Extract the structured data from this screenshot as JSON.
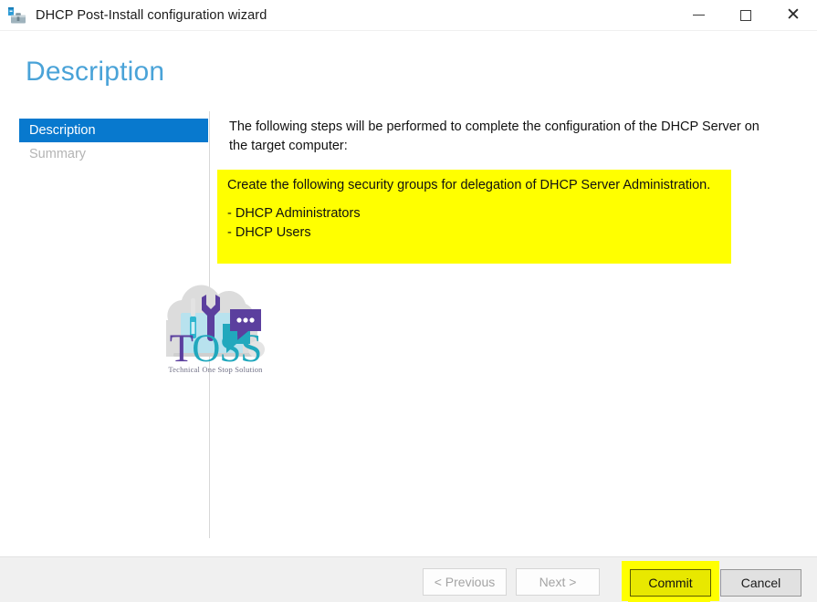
{
  "window": {
    "title": "DHCP Post-Install configuration wizard",
    "icon": "dhcp-toolbox-icon",
    "controls": {
      "minimize": "minimize-icon",
      "maximize": "maximize-icon",
      "close": "close-icon"
    }
  },
  "page": {
    "heading": "Description",
    "heading_color": "#4aa3d8"
  },
  "sidebar": {
    "items": [
      {
        "label": "Description",
        "state": "active"
      },
      {
        "label": "Summary",
        "state": "disabled"
      }
    ],
    "active_bg": "#0879ce"
  },
  "main": {
    "intro": "The following steps will be performed to complete the configuration of the DHCP Server on the target computer:",
    "highlight": {
      "bg_color": "#ffff00",
      "heading": "Create the following security groups for delegation of DHCP Server Administration.",
      "items": [
        "- DHCP Administrators",
        "- DHCP Users"
      ]
    }
  },
  "watermark": {
    "brand_letters": [
      "T",
      "O",
      "S",
      "S"
    ],
    "tagline": "Technical One Stop Solution",
    "purple": "#5b3f9e",
    "teal": "#21a8bd"
  },
  "footer": {
    "buttons": [
      {
        "label": "< Previous",
        "state": "disabled"
      },
      {
        "label": "Next >",
        "state": "disabled"
      },
      {
        "label": "Commit",
        "state": "highlighted"
      },
      {
        "label": "Cancel",
        "state": "enabled"
      }
    ],
    "previous_label": "< Previous",
    "next_label": "Next >",
    "commit_label": "Commit",
    "cancel_label": "Cancel",
    "highlight_color": "#ffff00"
  }
}
